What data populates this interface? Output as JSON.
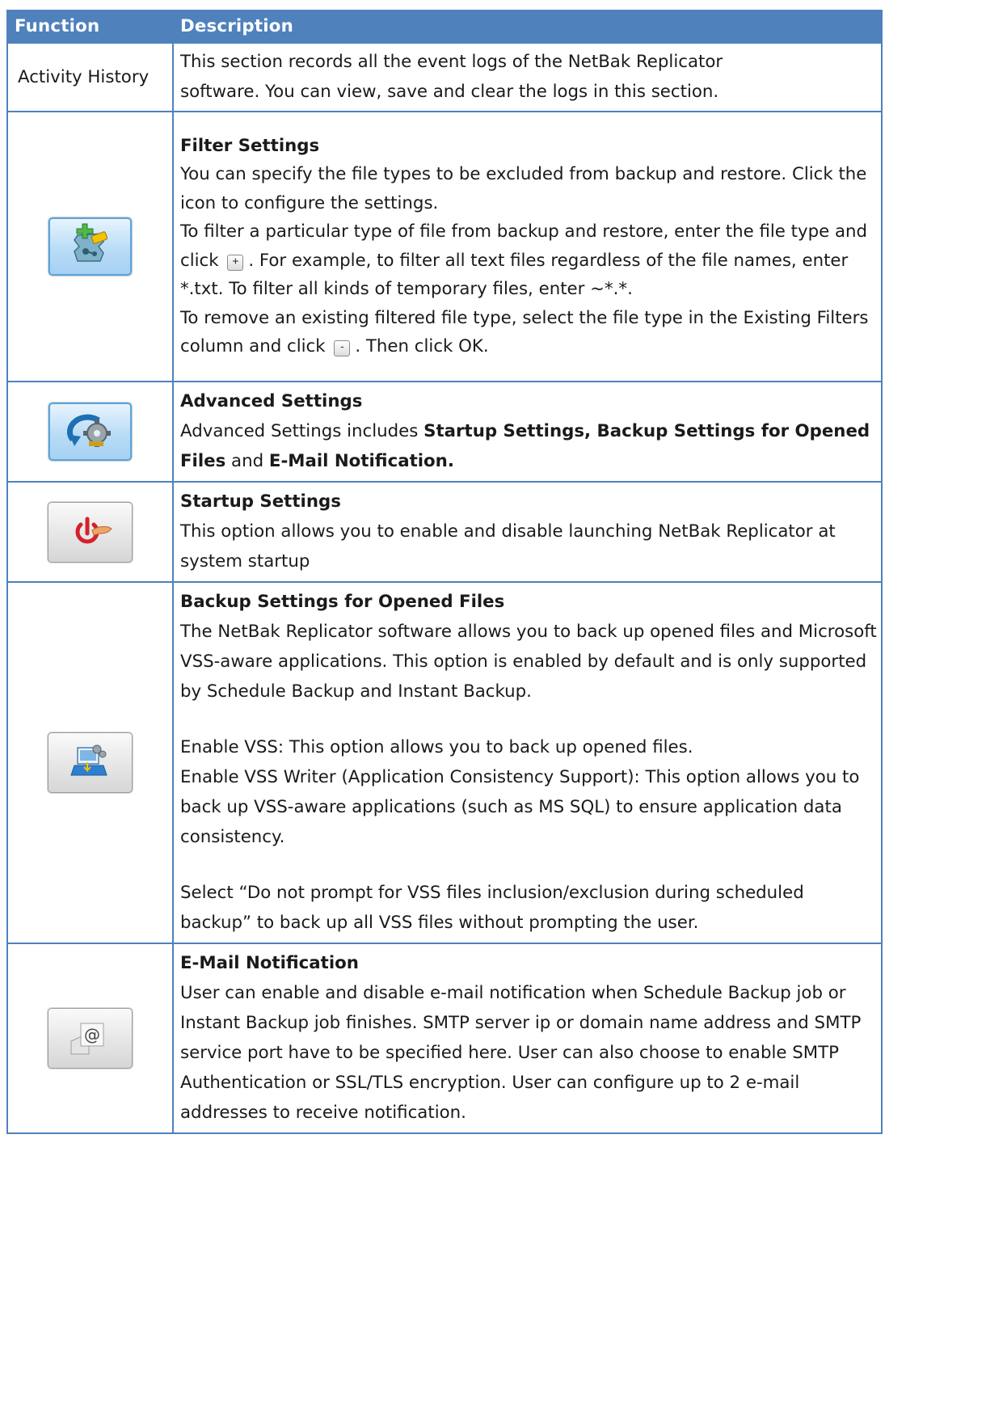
{
  "header": {
    "function": "Function",
    "description": "Description"
  },
  "rows": {
    "activity": {
      "function_label": "Activity History",
      "line1": "This section records all the event logs of the NetBak Replicator",
      "line2": "software.   You can view, save and clear the logs in this section."
    },
    "filter": {
      "icon": "filter-settings-icon",
      "title": "Filter Settings",
      "p1": "You can specify the file types to be excluded from backup and restore. Click the icon to configure the settings.",
      "p2a": "To filter a particular type of file from backup and restore, enter the file type and click",
      "p2b": ".   For example, to filter all text files regardless of the file names, enter *.txt.   To filter all kinds of temporary files, enter ~*.*.",
      "p3a": "To remove an existing filtered file type, select the file type in the Existing Filters column and click",
      "p3b": ".   Then click OK.",
      "add_glyph": "+",
      "remove_glyph": "-"
    },
    "advanced": {
      "icon": "advanced-settings-icon",
      "title": "Advanced Settings",
      "t1": "Advanced Settings includes ",
      "b1": "Startup Settings, Backup Settings for Opened Files",
      "t2": " and ",
      "b2": "E-Mail Notification."
    },
    "startup": {
      "icon": "power-hand-icon",
      "title": "Startup Settings",
      "p1": "This option allows you to enable and disable launching NetBak Replicator at system startup"
    },
    "vss": {
      "icon": "open-files-backup-icon",
      "title": "Backup Settings for Opened Files",
      "p1": "The NetBak Replicator software allows you to back up opened files and Microsoft VSS-aware applications.   This option is enabled by default and is only supported by Schedule Backup and Instant Backup.",
      "p2": "Enable VSS: This option allows you to back up opened files.",
      "p3": "Enable VSS Writer (Application Consistency Support): This option allows you to back up VSS-aware applications (such as MS SQL) to ensure application data consistency.",
      "p4": "Select “Do not prompt for VSS files inclusion/exclusion during scheduled backup” to back up all VSS files without prompting the user."
    },
    "email": {
      "icon": "email-at-icon",
      "title": "E-Mail Notification",
      "p1": "User can enable and disable e-mail notification when Schedule Backup job or Instant Backup job finishes.   SMTP server ip or domain name address and SMTP service port have to be specified here. User can also choose to enable SMTP Authentication or SSL/TLS encryption.   User can configure up to 2 e-mail addresses to receive notification."
    }
  }
}
